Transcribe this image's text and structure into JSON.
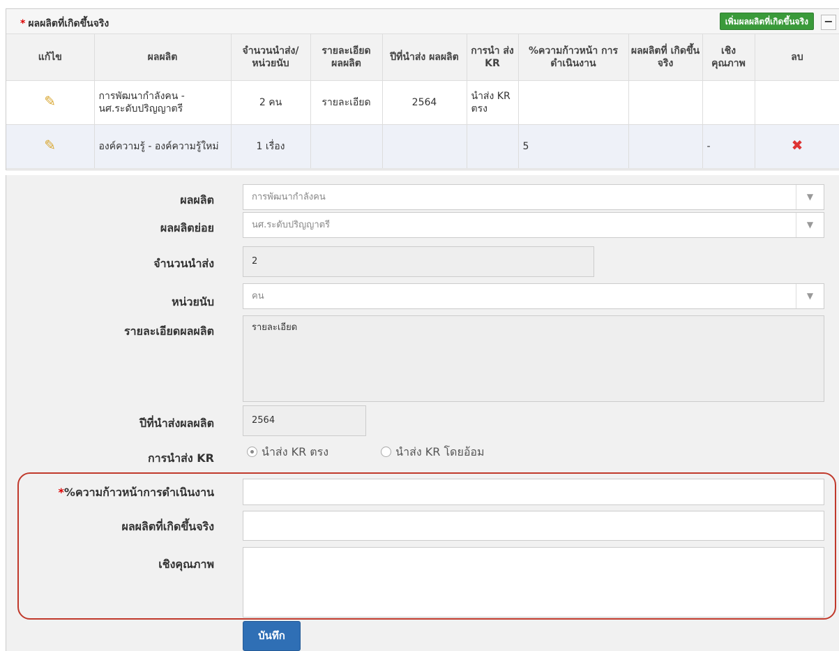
{
  "panel": {
    "required_mark": "*",
    "title": "ผลผลิตที่เกิดขึ้นจริง",
    "add_button": "เพิ่มผลผลิตที่เกิดขึ้นจริง",
    "minimize_button": "−"
  },
  "table": {
    "headers": [
      "แก้ไข",
      "ผลผลิต",
      "จำนวนนำส่ง/ หน่วยนับ",
      "รายละเอียด ผลผลิต",
      "ปีที่นำส่ง ผลผลิต",
      "การนำ ส่ง KR",
      "%ความก้าวหน้า การดำเนินงาน",
      "ผลผลิตที่ เกิดขึ้นจริง",
      "เชิง คุณภาพ",
      "ลบ"
    ],
    "rows": [
      {
        "edit_icon": "pencil-icon",
        "product": "การพัฒนากำลังคน - นศ.ระดับปริญญาตรี",
        "quantity": "2 คน",
        "detail": "รายละเอียด",
        "year": "2564",
        "kr": "นำส่ง KR ตรง",
        "progress": "",
        "actual": "",
        "quality": "",
        "delete_icon": ""
      },
      {
        "edit_icon": "pencil-icon",
        "product": "องค์ความรู้ - องค์ความรู้ใหม่",
        "quantity": "1 เรื่อง",
        "detail": "",
        "year": "",
        "kr": "",
        "progress": "5",
        "actual": "",
        "quality": "-",
        "delete_icon": "delete-x-icon"
      }
    ]
  },
  "form": {
    "product_label": "ผลผลิต",
    "product_value": "การพัฒนากำลังคน",
    "subproduct_label": "ผลผลิตย่อย",
    "subproduct_value": "นศ.ระดับปริญญาตรี",
    "amount_label": "จำนวนนำส่ง",
    "amount_value": "2",
    "unit_label": "หน่วยนับ",
    "unit_value": "คน",
    "detail_label": "รายละเอียดผลผลิต",
    "detail_value": "รายละเอียด",
    "year_label": "ปีที่นำส่งผลผลิต",
    "year_value": "2564",
    "kr_label": "การนำส่ง KR",
    "kr_options": [
      "นำส่ง KR ตรง",
      "นำส่ง KR โดยอ้อม"
    ],
    "kr_selected": "นำส่ง KR ตรง",
    "progress_required": "*",
    "progress_label": "%ความก้าวหน้าการดำเนินงาน",
    "progress_value": "",
    "actual_label": "ผลผลิตที่เกิดขึ้นจริง",
    "actual_value": "",
    "quality_label": "เชิงคุณภาพ",
    "quality_value": "",
    "save_button": "บันทึก"
  },
  "colors": {
    "add_button": "#3a9a3a",
    "save_button": "#2f6fb5",
    "highlight": "#c0392b",
    "required": "#dd0000"
  }
}
